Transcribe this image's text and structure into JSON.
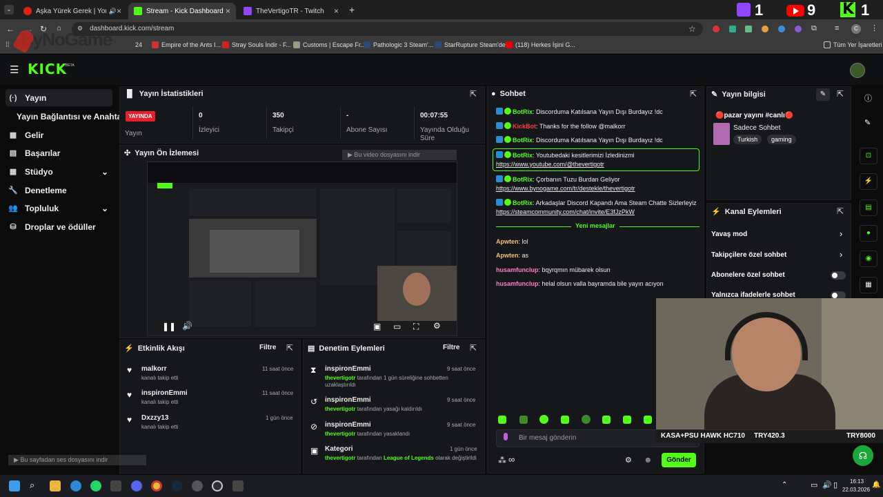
{
  "browser": {
    "tabs": [
      {
        "title": "Aşka Yürek Gerek | YouTube",
        "active": false
      },
      {
        "title": "Stream - Kick Dashboard",
        "active": true
      },
      {
        "title": "TheVertigoTR - Twitch",
        "active": false
      }
    ],
    "url": "dashboard.kick.com/stream",
    "bookmarks": [
      "Empire of the Ants I...",
      "Stray Souls İndir - F...",
      "Customs | Escape Fr...",
      "Pathologic 3 Steam'...",
      "StarRupture Steam'de",
      "(118) Herkes İşini G..."
    ],
    "bookmark_folder": "Tüm Yer İşaretleri",
    "partial_bookmark": "24",
    "watermark": "ByNoGame"
  },
  "overlay": {
    "twitch_count": "1",
    "youtube_count": "9",
    "kick_count": "1"
  },
  "kick": {
    "logo": "KICK",
    "beta": "BETA"
  },
  "sidebar": {
    "items": [
      {
        "label": "Yayın",
        "icon": "(·)"
      },
      {
        "label": "Yayın Bağlantısı ve Anahtarı",
        "icon": ""
      },
      {
        "label": "Gelir",
        "icon": "▦"
      },
      {
        "label": "Başarılar",
        "icon": "▤"
      },
      {
        "label": "Stüdyo",
        "icon": "▦"
      },
      {
        "label": "Denetleme",
        "icon": "🔧"
      },
      {
        "label": "Topluluk",
        "icon": "👥"
      },
      {
        "label": "Droplar ve ödüller",
        "icon": "⛁"
      }
    ]
  },
  "stats": {
    "title": "Yayın İstatistikleri",
    "live_badge": "YAYINDA",
    "items": [
      {
        "value": "",
        "label": "Yayın"
      },
      {
        "value": "0",
        "label": "İzleyici"
      },
      {
        "value": "350",
        "label": "Takipçi"
      },
      {
        "value": "-",
        "label": "Abone Sayısı"
      },
      {
        "value": "00:07:55",
        "label": "Yayında Olduğu Süre"
      }
    ]
  },
  "preview": {
    "title": "Yayın Ön İzlemesi",
    "download_hint": "Bu video dosyasını indir"
  },
  "activity": {
    "title": "Etkinlik Akışı",
    "filter": "Filtre",
    "items": [
      {
        "name": "malkorr",
        "sub": "kanalı takip etti",
        "time": "11 saat önce"
      },
      {
        "name": "inspironEmmi",
        "sub": "kanalı takip etti",
        "time": "11 saat önce"
      },
      {
        "name": "Dxzzy13",
        "sub": "kanalı takip etti",
        "time": "1 gün önce"
      }
    ]
  },
  "moderation": {
    "title": "Denetim Eylemleri",
    "filter": "Filtre",
    "items": [
      {
        "name": "inspironEmmi",
        "actor": "thevertigotr",
        "sub": "tarafından 1 gün süreliğine sohbetten uzaklaştırıldı",
        "time": "9 saat önce"
      },
      {
        "name": "inspironEmmi",
        "actor": "thevertigotr",
        "sub": "tarafından yasağı kaldırıldı",
        "time": "9 saat önce"
      },
      {
        "name": "inspironEmmi",
        "actor": "thevertigotr",
        "sub": "tarafından yasaklandı",
        "time": "9 saat önce"
      },
      {
        "name": "Kategori",
        "actor": "thevertigotr",
        "sub": "tarafından",
        "extra": "League of Legends",
        "extra2": "olarak değiştirildi",
        "time": "1 gün önce"
      }
    ]
  },
  "chat": {
    "title": "Sohbet",
    "messages": [
      {
        "user": "BotRix",
        "text": "Discorduma Katılsana Yayın Dışı Burdayız !dc"
      },
      {
        "user": "KickBot",
        "text": "Thanks for the follow @malkorr"
      },
      {
        "user": "BotRix",
        "text": "Discorduma Katılsana Yayın Dışı Burdayız !dc"
      },
      {
        "user": "BotRix",
        "text": "Youtubedaki kesitlerimizi İzledinizmi",
        "link": "https://www.youtube.com/@thevertigotr"
      },
      {
        "user": "BotRix",
        "text": "Çorbanın Tuzu Burdan Geliyor",
        "link": "https://www.bynogame.com/tr/destekle/thevertigotr"
      },
      {
        "user": "BotRix",
        "text": "Arkadaşlar Discord Kapandı Ama Steam Chatte Sizlerleyiz",
        "link": "https://steamcommunity.com/chat/invite/E3fJzPkW"
      }
    ],
    "new_messages": "Yeni mesajlar",
    "recent": [
      {
        "user": "Apwten",
        "text": "lol"
      },
      {
        "user": "Apwten",
        "text": "as"
      },
      {
        "user": "husamfunclup",
        "text": "bqyrqmın mübarek olsun"
      },
      {
        "user": "husamfunclup",
        "text": "helal olsun valla bayramda bile yayın acıyon"
      }
    ],
    "placeholder": "Bir mesaj gönderin",
    "send": "Gönder",
    "infinity": "∞"
  },
  "stream_info": {
    "title": "Yayın bilgisi",
    "stream_title": "🔴pazar yayını #canlı🔴",
    "category": "Sadece Sohbet",
    "tags": [
      "Turkish",
      "gaming"
    ]
  },
  "channel_actions": {
    "title": "Kanal Eylemleri",
    "items": [
      {
        "label": "Yavaş mod",
        "kind": "arrow"
      },
      {
        "label": "Takipçilere özel sohbet",
        "kind": "arrow"
      },
      {
        "label": "Abonelere özel sohbet",
        "kind": "toggle"
      },
      {
        "label": "Yalnızca ifadelerle sohbet",
        "kind": "toggle"
      }
    ]
  },
  "ticker": {
    "name": "KASA+PSU HAWK HC710",
    "price1": "TRY420.3",
    "price2": "TRY8000"
  },
  "page_audio_hint": "Bu sayfadan ses dosyasını indir",
  "clock": {
    "time": "16:13",
    "date": "22.03.2026"
  }
}
